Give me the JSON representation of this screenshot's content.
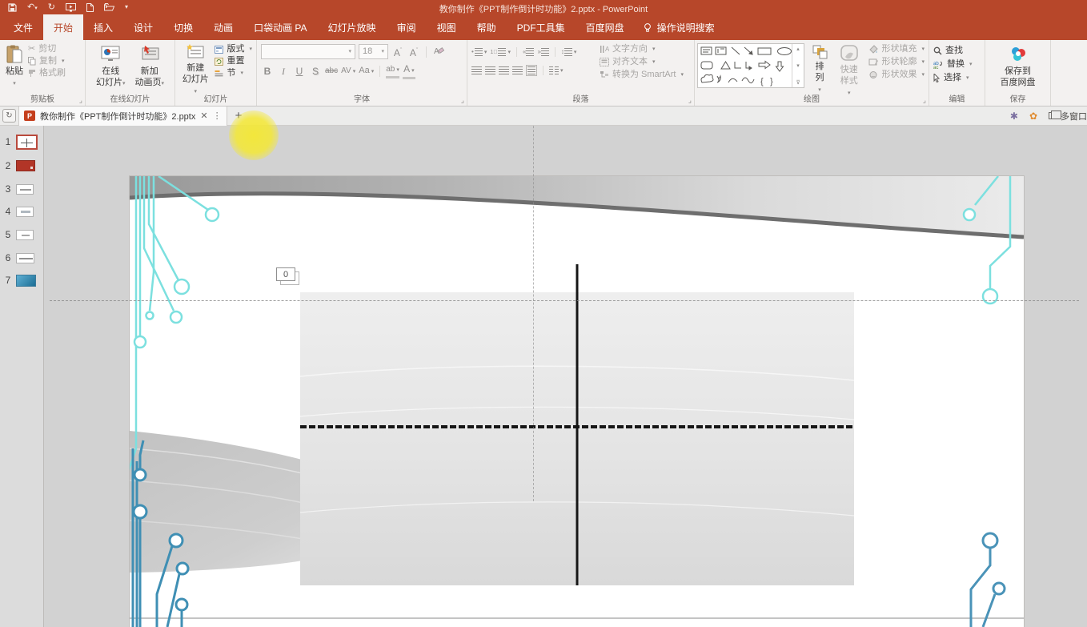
{
  "titlebar": {
    "title": "教你制作《PPT制作倒计时功能》2.pptx  -  PowerPoint"
  },
  "tabs": {
    "file": "文件",
    "home": "开始",
    "insert": "插入",
    "design": "设计",
    "transitions": "切换",
    "animations": "动画",
    "pocket": "口袋动画 PA",
    "slideshow": "幻灯片放映",
    "review": "审阅",
    "view": "视图",
    "help": "帮助",
    "pdf": "PDF工具集",
    "netdisk": "百度网盘",
    "tellme": "操作说明搜索"
  },
  "ribbon": {
    "clipboard": {
      "label": "剪贴板",
      "paste": "粘贴",
      "cut": "剪切",
      "copy": "复制",
      "painter": "格式刷"
    },
    "online": {
      "label": "在线幻灯片",
      "b1l1": "在线",
      "b1l2": "幻灯片",
      "b2l1": "新加",
      "b2l2": "动画页"
    },
    "slides": {
      "label": "幻灯片",
      "newl1": "新建",
      "newl2": "幻灯片",
      "layout": "版式",
      "reset": "重置",
      "section": "节"
    },
    "font": {
      "label": "字体",
      "size": "18",
      "bold": "B",
      "italic": "I",
      "underline": "U",
      "shadow": "S",
      "strike": "abc",
      "spacing": "AV",
      "case": "Aa",
      "highlight": "ab",
      "color": "A"
    },
    "para": {
      "label": "段落",
      "dir": "文字方向",
      "align": "对齐文本",
      "smart": "转换为 SmartArt"
    },
    "draw": {
      "label": "绘图",
      "arrange": "排列",
      "quick": "快速样式",
      "fill": "形状填充",
      "outline": "形状轮廓",
      "effects": "形状效果"
    },
    "edit": {
      "label": "编辑",
      "find": "查找",
      "replace": "替换",
      "select": "选择"
    },
    "save": {
      "label": "保存",
      "l1": "保存到",
      "l2": "百度网盘"
    }
  },
  "tabbar": {
    "doc_title": "教你制作《PPT制作倒计时功能》2.pptx",
    "multi_window": "多窗口"
  },
  "panel": {
    "slides": [
      "1",
      "2",
      "3",
      "4",
      "5",
      "6",
      "7"
    ]
  },
  "slide": {
    "zero": "0"
  },
  "colors": {
    "titlebar_red": "#B7472A",
    "circuit_cyan": "#7CE0DF",
    "circuit_blue": "#3F8FB4",
    "highlight_yellow": "#F2E634",
    "selected_thumb_border": "#B94A3D"
  }
}
